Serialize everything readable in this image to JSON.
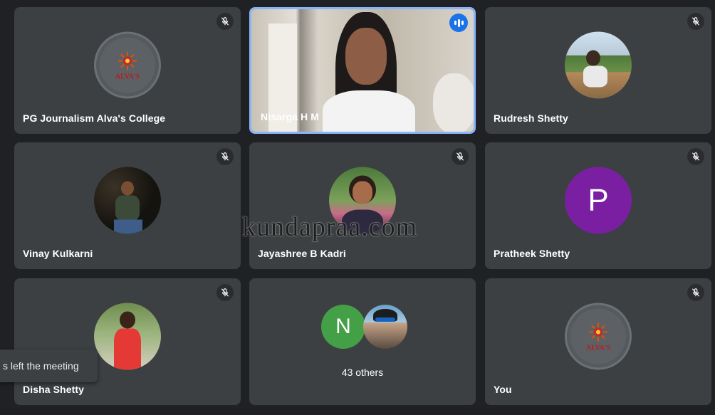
{
  "participants": [
    {
      "name": "PG Journalism Alva's College",
      "type": "logo",
      "logo_text": "ALVA'S",
      "muted": true
    },
    {
      "name": "Nisarga H M",
      "type": "video",
      "speaking": true
    },
    {
      "name": "Rudresh Shetty",
      "type": "photo",
      "muted": true
    },
    {
      "name": "Vinay Kulkarni",
      "type": "photo",
      "muted": true
    },
    {
      "name": "Jayashree B Kadri",
      "type": "photo",
      "muted": true
    },
    {
      "name": "Pratheek Shetty",
      "type": "letter",
      "letter": "P",
      "color": "#7b1fa2",
      "muted": true
    },
    {
      "name": "Disha Shetty",
      "type": "photo",
      "muted": true
    },
    {
      "name": "",
      "type": "others",
      "letter": "N",
      "letter_color": "#43a047",
      "label": "43 others"
    },
    {
      "name": "You",
      "type": "logo",
      "logo_text": "ALVA'S",
      "muted": true
    }
  ],
  "toast": {
    "text": "s left the meeting"
  },
  "watermark": "kundapraa.com",
  "colors": {
    "tile": "#3c4043",
    "background": "#202124",
    "active_border": "#8ab4f8",
    "speaking": "#1a73e8"
  }
}
